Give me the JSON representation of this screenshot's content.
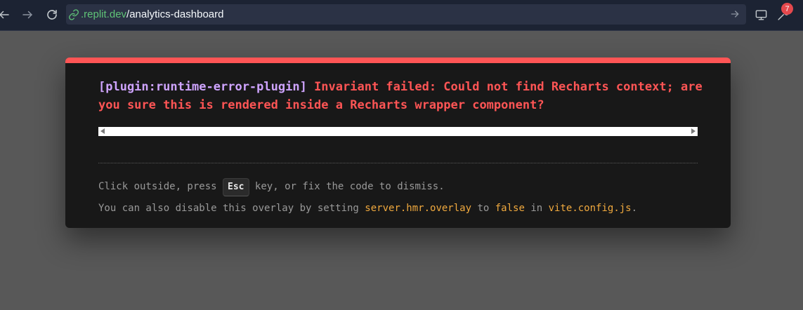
{
  "browser": {
    "url_domain": ".replit.dev",
    "url_path": "/analytics-dashboard",
    "notification_count": "7",
    "icons": {
      "back": "arrow-left-icon",
      "forward": "arrow-right-icon",
      "reload": "reload-icon",
      "link": "link-icon",
      "go": "arrow-right-icon",
      "devices": "monitor-icon",
      "tools": "wrench-icon"
    }
  },
  "error_overlay": {
    "plugin": "[plugin:runtime-error-plugin]",
    "message": "Invariant failed: Could not find Recharts context; are you sure this is rendered inside a Recharts wrapper component?",
    "tip_line1_before": "Click outside, press ",
    "tip_key": "Esc",
    "tip_line1_after": " key, or fix the code to dismiss.",
    "tip_line2_prefix": "You can also disable this overlay by setting ",
    "tip_line2_setting": "server.hmr.overlay",
    "tip_line2_to": " to ",
    "tip_line2_value": "false",
    "tip_line2_in": " in ",
    "tip_line2_file": "vite.config.js",
    "tip_line2_end": ".",
    "colors": {
      "accent_red": "#ff5555",
      "plugin_purple": "#cfa4ff",
      "code_orange": "#f0a93e",
      "card_bg": "#181818"
    }
  }
}
